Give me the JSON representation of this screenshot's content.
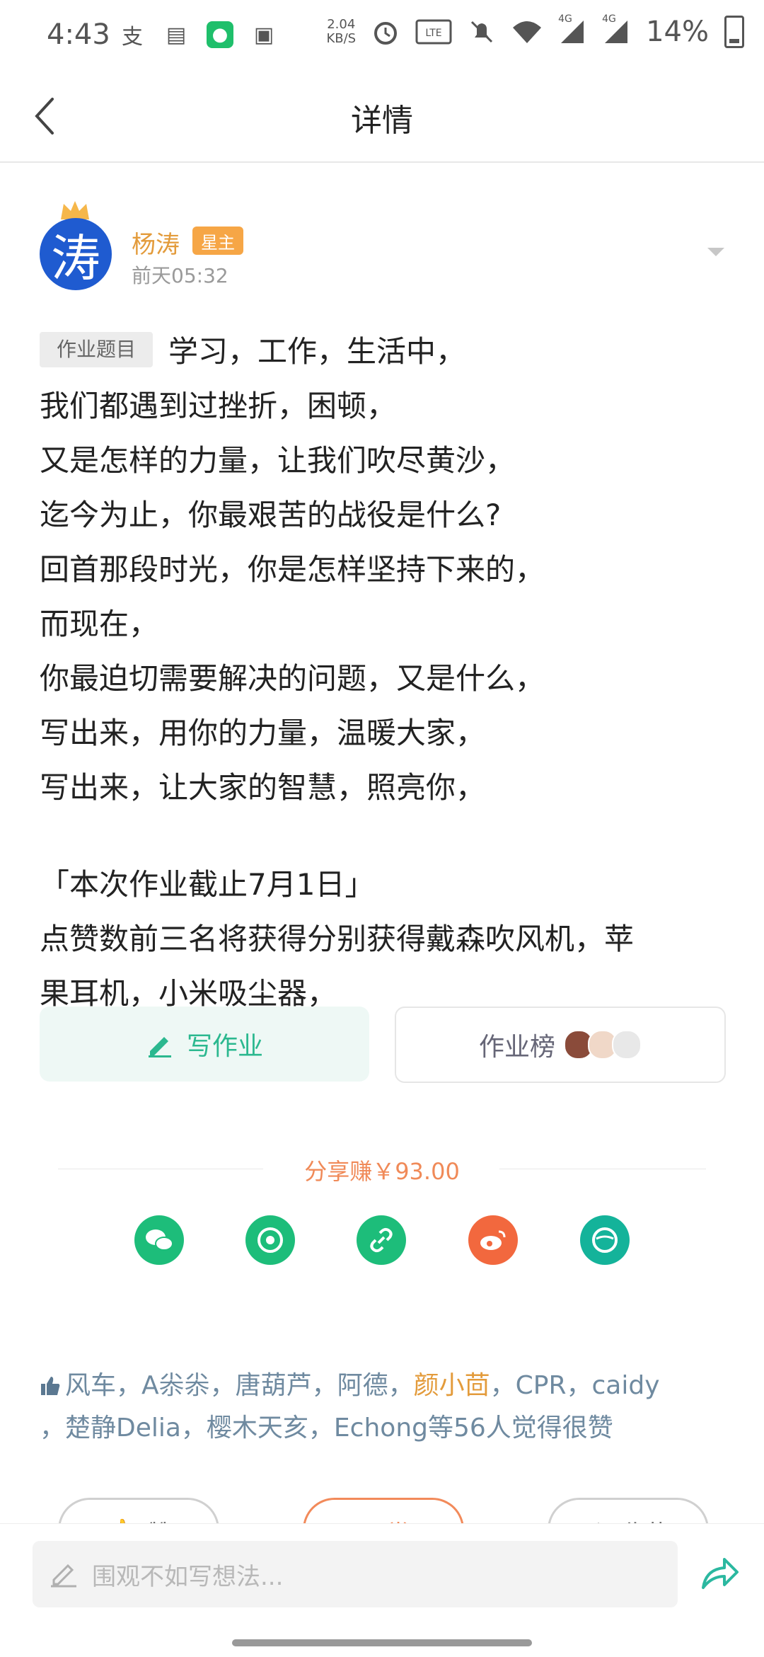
{
  "status_bar": {
    "time": "4:43",
    "net_speed_value": "2.04",
    "net_speed_unit": "KB/S",
    "network1": "4G",
    "network2": "4G",
    "battery": "14%"
  },
  "header": {
    "title": "详情"
  },
  "author": {
    "avatar_char": "涛",
    "name": "杨涛",
    "role": "星主",
    "time": "前天05:32"
  },
  "post": {
    "tag": "作业题目",
    "lines": [
      "学习，工作，生活中，",
      "我们都遇到过挫折，困顿，",
      "又是怎样的力量，让我们吹尽黄沙，",
      "迄今为止，你最艰苦的战役是什么?",
      "回首那段时光，你是怎样坚持下来的，",
      "而现在，",
      "你最迫切需要解决的问题，又是什么，",
      "写出来，用你的力量，温暖大家，",
      "写出来，让大家的智慧，照亮你，"
    ],
    "deadline": "「本次作业截止7月1日」",
    "prize_line1": "点赞数前三名将获得分别获得戴森吹风机，苹",
    "prize_line2": "果耳机，小米吸尘器，"
  },
  "actions": {
    "write_label": "写作业",
    "rank_label": "作业榜"
  },
  "share": {
    "label": "分享赚￥93.00",
    "targets": [
      "wechat-icon",
      "moments-icon",
      "link-icon",
      "weibo-icon",
      "planet-icon"
    ],
    "colors": {
      "green": "#1dbd7a",
      "weibo": "#f2683e",
      "teal": "#14b39a"
    }
  },
  "likes": {
    "part1": "风车，A尜尜，唐葫芦，阿德，",
    "highlight": "颜小茴",
    "part2": "，CPR，caidy",
    "line2": "，楚静Delia，樱木天亥，Echong等56人觉得很赞"
  },
  "bottom_buttons": {
    "like": "赞",
    "reward": "赏",
    "favorite": "收藏"
  },
  "comment": {
    "placeholder": "围观不如写想法..."
  }
}
